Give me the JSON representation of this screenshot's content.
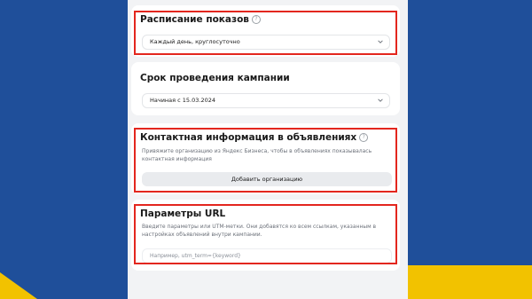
{
  "schedule": {
    "title": "Расписание показов",
    "value": "Каждый день, круглосуточно"
  },
  "duration": {
    "title": "Срок проведения кампании",
    "value": "Начиная с 15.03.2024"
  },
  "contact": {
    "title": "Контактная информация в объявлениях",
    "description": "Привяжите организацию из Яндекс Бизнеса, чтобы в объявлениях показывалась контактная информация",
    "button_label": "Добавить организацию"
  },
  "url_params": {
    "title": "Параметры URL",
    "description": "Введите параметры или UTM-метки. Они добавятся ко всем ссылкам, указанным в настройках объявлений внутри кампании.",
    "placeholder": "Например, utm_term={keyword}"
  },
  "colors": {
    "highlight": "#e3261e",
    "background_blue": "#1f4f9a",
    "accent_yellow": "#f2c200"
  }
}
